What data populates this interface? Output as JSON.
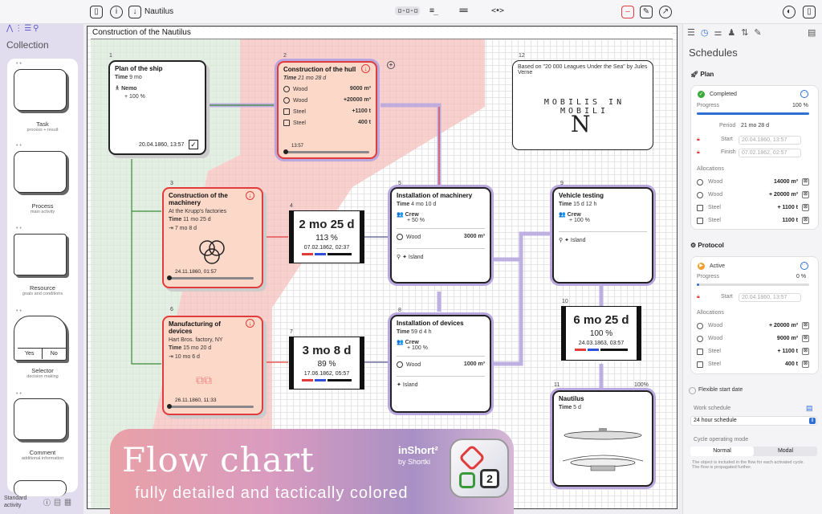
{
  "toolbar": {
    "doc_title": "Nautilus"
  },
  "sidebar": {
    "title": "Collection",
    "items": [
      {
        "label": "Task",
        "sub": "process + result"
      },
      {
        "label": "Process",
        "sub": "main activity"
      },
      {
        "label": "Resource",
        "sub": "goals and conditions"
      },
      {
        "label": "Selector",
        "sub": "decision making",
        "yes": "Yes",
        "no": "No"
      },
      {
        "label": "Comment",
        "sub": "additional information"
      }
    ],
    "footer": "Standard activity"
  },
  "canvas": {
    "title": "Construction of the Nautilus",
    "nodes": {
      "n1": {
        "num": "1",
        "title": "Plan of the ship",
        "time_label": "Time",
        "time": "9 mo",
        "person": "Nemo",
        "person_pct": "+ 100 %",
        "date": "20.04.1860, 13:57"
      },
      "n2": {
        "num": "2",
        "title": "Construction of the hull",
        "time_label": "Time",
        "time": "21 mo 28 d",
        "r1": "Wood",
        "r1v": "9000 m³",
        "r2": "Wood",
        "r2v": "+20000 m³",
        "r3": "Steel",
        "r3v": "+1100 t",
        "r4": "Steel",
        "r4v": "400 t",
        "date": "13:57"
      },
      "n3": {
        "num": "3",
        "title": "Construction of the machinery",
        "sub": "At the Krupp's factories",
        "time_label": "Time",
        "time": "11 mo 25 d",
        "dur": "7 mo 8 d",
        "date": "24.11.1860, 01:57"
      },
      "n4": {
        "num": "4",
        "big": "2 mo 25 d",
        "pct": "113 %",
        "date": "07.02.1862, 02:37"
      },
      "n5": {
        "num": "5",
        "title": "Installation of machinery",
        "time_label": "Time",
        "time": "4 mo 10 d",
        "crew": "Crew",
        "crew_pct": "+ 50 %",
        "res": "Wood",
        "resv": "3000 m³",
        "island": "Island"
      },
      "n6": {
        "num": "6",
        "title": "Manufacturing of devices",
        "sub": "Hart Bros. factory, NY",
        "time_label": "Time",
        "time": "15 mo 20 d",
        "dur": "10 mo 6 d",
        "date": "26.11.1860, 11:33"
      },
      "n7": {
        "num": "7",
        "big": "3 mo 8 d",
        "pct": "89 %",
        "date": "17.06.1862, 05:57"
      },
      "n8": {
        "num": "8",
        "title": "Installation of devices",
        "time_label": "Time",
        "time": "59 d 4 h",
        "crew": "Crew",
        "crew_pct": "+ 100 %",
        "res": "Wood",
        "resv": "1000 m³",
        "island": "Island"
      },
      "n9": {
        "num": "9",
        "title": "Vehicle testing",
        "time_label": "Time",
        "time": "15 d 12 h",
        "crew": "Crew",
        "crew_pct": "+ 100 %",
        "island": "Island"
      },
      "n10": {
        "num": "10",
        "big": "6 mo 25 d",
        "pct": "100 %",
        "date": "24.03.1863, 03:57"
      },
      "n11": {
        "num": "11",
        "title": "Nautilus",
        "time_label": "Time",
        "time": "5 d",
        "pct": "100%"
      },
      "n12": {
        "num": "12",
        "text": "Based on \"20 000 Leagues Under the Sea\" by Jules Verne",
        "motto": "MOBILIS IN MOBILI"
      }
    }
  },
  "promo": {
    "title": "Flow chart",
    "subtitle": "fully detailed and tactically colored",
    "brand": "inShort²",
    "by": "by Shortki"
  },
  "panel": {
    "title": "Schedules",
    "plan": {
      "heading": "Plan",
      "status": "Completed",
      "progress_label": "Progress",
      "progress": "100 %",
      "progress_value": 1.0,
      "period_label": "Period",
      "period": "21 mo 28 d",
      "start_label": "Start",
      "start": "20.04.1860, 13:57",
      "finish_label": "Finish",
      "finish": "07.02.1862, 02:57",
      "alloc_label": "Allocations",
      "allocs": [
        {
          "name": "Wood",
          "val": "14000 m³"
        },
        {
          "name": "Wood",
          "val": "+ 20000 m³"
        },
        {
          "name": "Steel",
          "val": "+ 1100 t"
        },
        {
          "name": "Steel",
          "val": "1100 t"
        }
      ]
    },
    "protocol": {
      "heading": "Protocol",
      "status": "Active",
      "progress_label": "Progress",
      "progress": "0 %",
      "progress_value": 0.0,
      "start_label": "Start",
      "start": "20.04.1860, 13:57",
      "alloc_label": "Allocations",
      "allocs": [
        {
          "name": "Wood",
          "val": "+ 20000 m³"
        },
        {
          "name": "Wood",
          "val": "9000 m³"
        },
        {
          "name": "Steel",
          "val": "+ 1100 t"
        },
        {
          "name": "Steel",
          "val": "400 t"
        }
      ]
    },
    "flex_label": "Flexible start date",
    "work_label": "Work schedule",
    "work_value": "24 hour schedule",
    "cycle_label": "Cycle operating mode",
    "cycle_opts": [
      "Normal",
      "Modal"
    ],
    "note": "The object is included in the flow for each activated cycle. The flow is propagated further."
  },
  "colors": {
    "accent": "#2f6fd6",
    "purple": "#b9a8e0",
    "red": "#e23b3b",
    "salmon": "#f7c9c4",
    "green": "#d8ecd8"
  }
}
